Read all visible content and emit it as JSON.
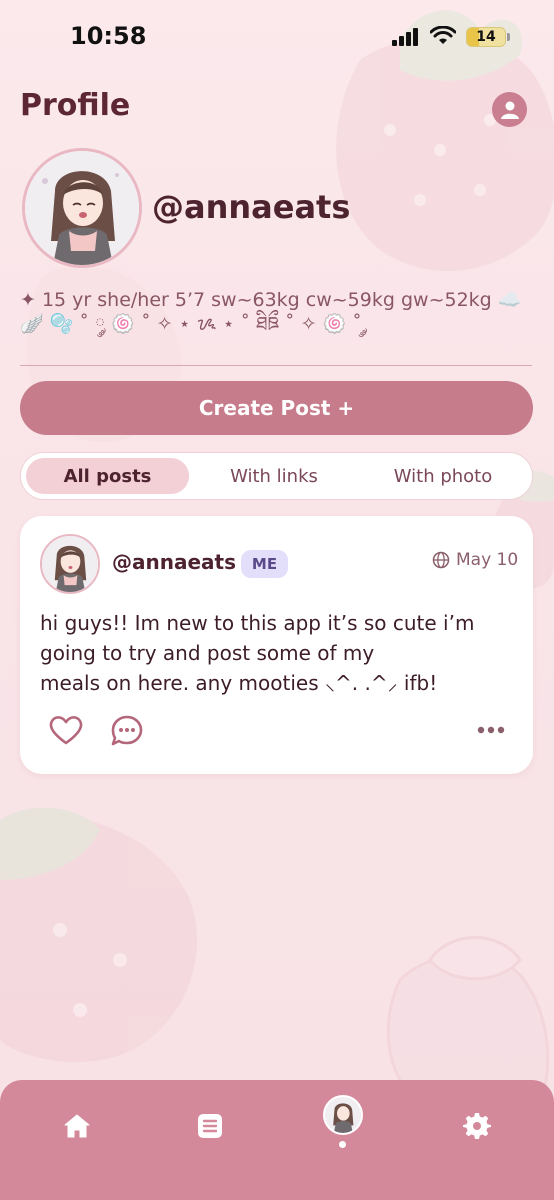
{
  "status": {
    "time": "10:58",
    "battery": "14"
  },
  "header": {
    "title": "Profile"
  },
  "profile": {
    "username": "@annaeats",
    "bio": "✦ 15 yr she/her 5’7 sw~63kg cw~59kg gw~52kg ☁️ 🪽 🫧 ˚ ༘ 🍥 ˚ ✧ ⋆ ᝰ ⋆ ˚ ཐིཋྀ ˚ ✧ 🍥 ˚ ༘"
  },
  "actions": {
    "create_post": "Create Post +"
  },
  "tabs": [
    {
      "label": "All posts"
    },
    {
      "label": "With links"
    },
    {
      "label": "With photo"
    }
  ],
  "post": {
    "username": "@annaeats",
    "badge": "ME",
    "date": "May 10",
    "text": "hi guys!! Im new to this app it’s so cute i’m going to try and post some of my\nmeals on here. any mooties ⸜^. .^⸝ ifb!"
  },
  "colors": {
    "accent": "#c77c8b",
    "nav_background": "#d4899a",
    "badge_background": "#e3defa"
  },
  "icons": [
    "signal-icon",
    "wifi-icon",
    "battery-icon",
    "account-icon",
    "globe-icon",
    "heart-icon",
    "comment-icon",
    "more-icon",
    "home-icon",
    "list-icon",
    "settings-icon"
  ]
}
